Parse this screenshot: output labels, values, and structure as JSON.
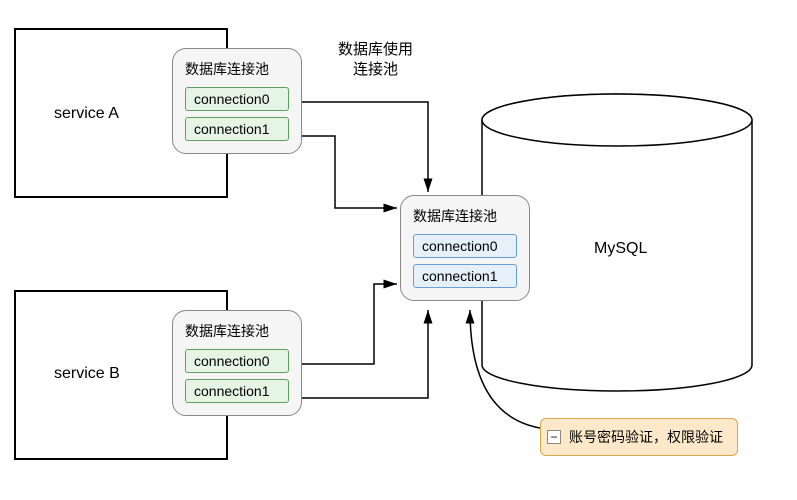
{
  "labels": {
    "serviceA": "service A",
    "serviceB": "service B",
    "dbUsePool_line1": "数据库使用",
    "dbUsePool_line2": "连接池",
    "mysql": "MySQL"
  },
  "poolA": {
    "title": "数据库连接池",
    "conn0": "connection0",
    "conn1": "connection1"
  },
  "poolB": {
    "title": "数据库连接池",
    "conn0": "connection0",
    "conn1": "connection1"
  },
  "poolDB": {
    "title": "数据库连接池",
    "conn0": "connection0",
    "conn1": "connection1"
  },
  "note": {
    "text": "账号密码验证，权限验证"
  }
}
